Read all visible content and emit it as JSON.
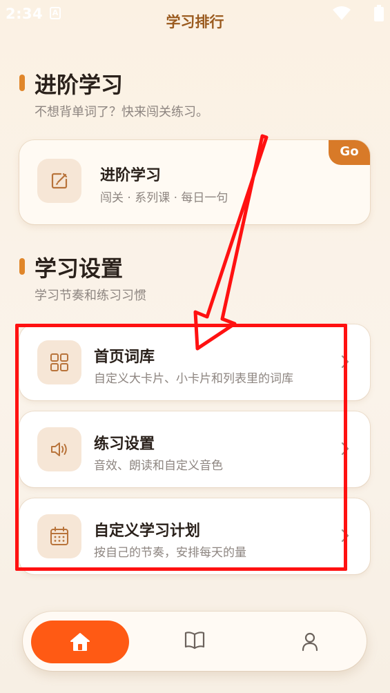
{
  "status_bar": {
    "time": "2:34",
    "notification_letter": "A"
  },
  "page": {
    "title": "学习排行"
  },
  "advanced_section": {
    "title": "进阶学习",
    "subtitle": "不想背单词了？快来闯关练习。",
    "card": {
      "title": "进阶学习",
      "subtitle": "闯关 · 系列课 · 每日一句",
      "badge": "Go",
      "icon": "edit-icon"
    }
  },
  "settings_section": {
    "title": "学习设置",
    "subtitle": "学习节奏和练习习惯",
    "items": [
      {
        "title": "首页词库",
        "subtitle": "自定义大卡片、小卡片和列表里的词库",
        "icon": "grid-icon"
      },
      {
        "title": "练习设置",
        "subtitle": "音效、朗读和自定义音色",
        "icon": "speaker-icon"
      },
      {
        "title": "自定义学习计划",
        "subtitle": "按自己的节奏，安排每天的量",
        "icon": "calendar-icon"
      }
    ]
  },
  "bottom_nav": {
    "items": [
      {
        "icon": "home-icon",
        "active": true
      },
      {
        "icon": "book-icon",
        "active": false
      },
      {
        "icon": "profile-icon",
        "active": false
      }
    ]
  },
  "colors": {
    "accent": "#e0862a",
    "badge": "#d87a28",
    "title_brown": "#9a5a1e",
    "nav_active": "#ff5a14",
    "annotation_red": "#ff1111",
    "icon_bg": "#f6e6d6"
  }
}
